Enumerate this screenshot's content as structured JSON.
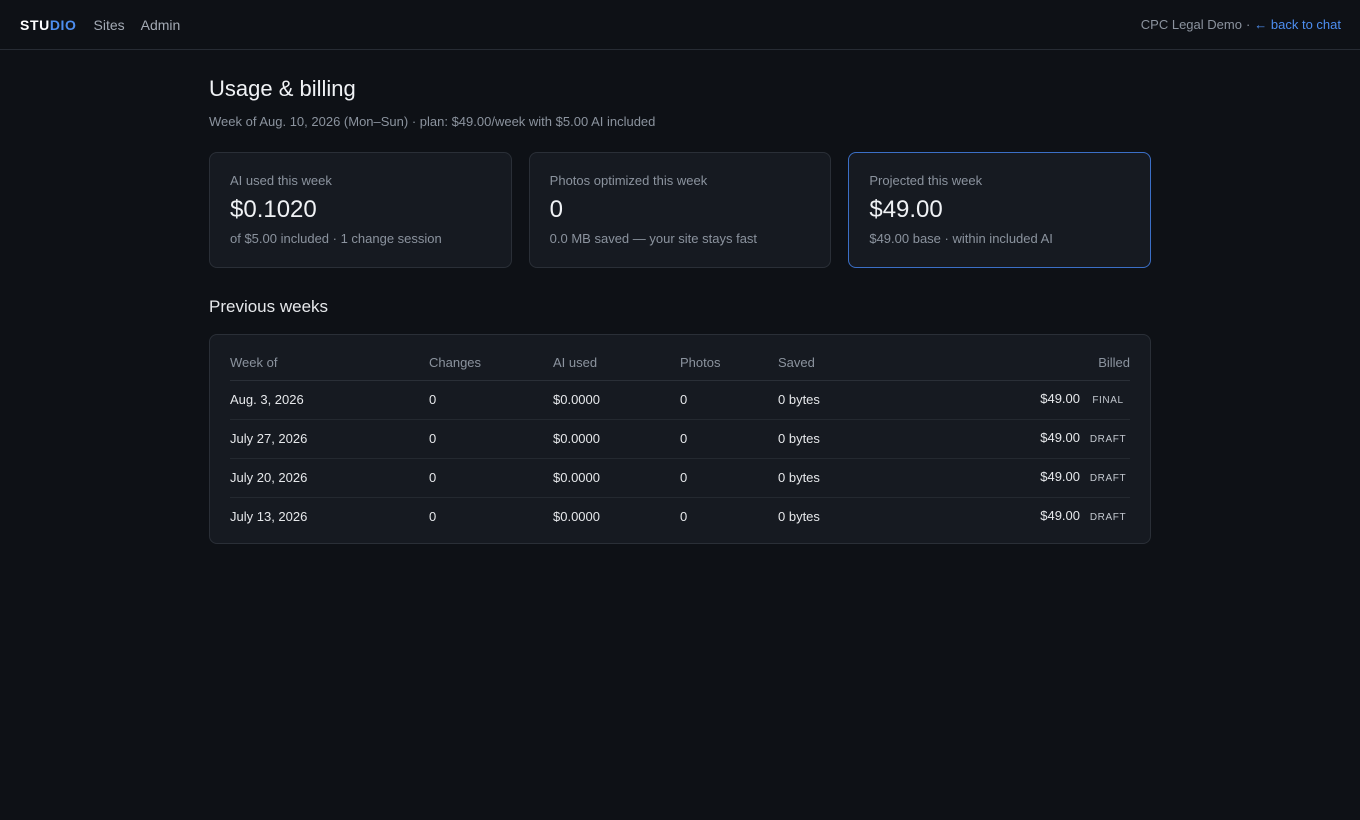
{
  "nav": {
    "brand_part1": "STU",
    "brand_part2": "DIO",
    "links": [
      "Sites",
      "Admin"
    ],
    "site_name": "CPC Legal Demo",
    "separator": "·",
    "back_label": "← back to chat"
  },
  "page": {
    "title": "Usage & billing",
    "subtitle": "Week of Aug. 10, 2026 (Mon–Sun) · plan: $49.00/week with $5.00 AI included"
  },
  "cards": [
    {
      "label": "AI used this week",
      "value": "$0.1020",
      "note": "of $5.00 included · 1 change session"
    },
    {
      "label": "Photos optimized this week",
      "value": "0",
      "note": "0.0 MB saved — your site stays fast"
    },
    {
      "label": "Projected this week",
      "value": "$49.00",
      "note": "$49.00 base · within included AI"
    }
  ],
  "previous": {
    "heading": "Previous weeks",
    "columns": [
      "Week of",
      "Changes",
      "AI used",
      "Photos",
      "Saved",
      "Billed"
    ],
    "rows": [
      {
        "week": "Aug. 3, 2026",
        "changes": "0",
        "ai": "$0.0000",
        "photos": "0",
        "saved": "0 bytes",
        "billed": "$49.00",
        "status": "FINAL"
      },
      {
        "week": "July 27, 2026",
        "changes": "0",
        "ai": "$0.0000",
        "photos": "0",
        "saved": "0 bytes",
        "billed": "$49.00",
        "status": "DRAFT"
      },
      {
        "week": "July 20, 2026",
        "changes": "0",
        "ai": "$0.0000",
        "photos": "0",
        "saved": "0 bytes",
        "billed": "$49.00",
        "status": "DRAFT"
      },
      {
        "week": "July 13, 2026",
        "changes": "0",
        "ai": "$0.0000",
        "photos": "0",
        "saved": "0 bytes",
        "billed": "$49.00",
        "status": "DRAFT"
      }
    ]
  },
  "colors": {
    "background": "#0e1116",
    "card": "#161a21",
    "accent": "#4d8ef0",
    "highlight_border": "#3b6fc6",
    "muted_text": "#8b939e"
  }
}
